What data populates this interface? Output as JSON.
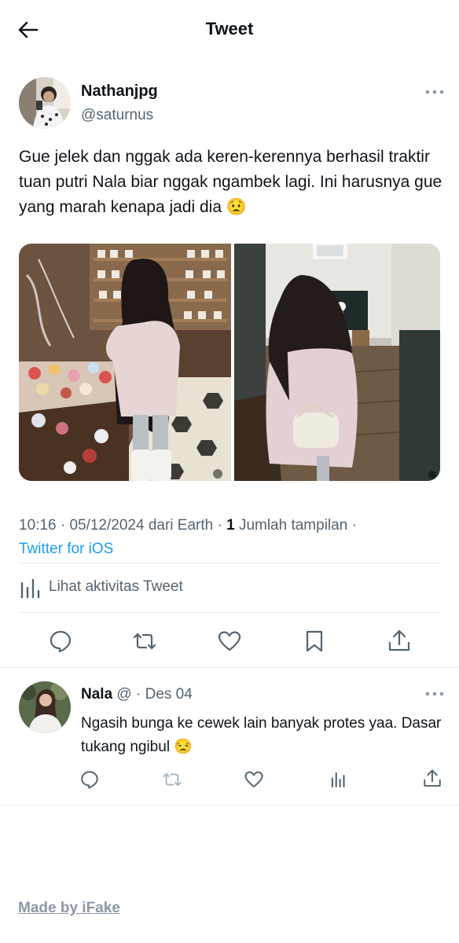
{
  "header": {
    "title": "Tweet",
    "back_icon": "arrow-left-icon"
  },
  "tweet": {
    "author": {
      "name": "Nathanjpg",
      "handle": "@saturnus"
    },
    "text": "Gue jelek dan nggak ada keren-kerennya berhasil traktir tuan putri Nala biar nggak ngambek lagi. Ini harusnya gue yang marah kenapa jadi dia 😟",
    "meta": {
      "time": "10:16",
      "date": "05/12/2024",
      "location": "dari Earth",
      "views_count": "1",
      "views_label": "Jumlah tampilan",
      "source": "Twitter for iOS"
    },
    "activity_label": "Lihat aktivitas Tweet",
    "actions": [
      "reply-icon",
      "retweet-icon",
      "like-icon",
      "bookmark-icon",
      "share-icon"
    ]
  },
  "reply": {
    "name": "Nala",
    "handle": "@",
    "date": "Des 04",
    "text": "Ngasih bunga ke cewek lain banyak protes yaa. Dasar tukang ngibul 😒",
    "actions": [
      "reply-icon",
      "retweet-icon",
      "like-icon",
      "views-icon",
      "share-icon"
    ]
  },
  "footer": {
    "watermark": "Made by iFake"
  },
  "colors": {
    "accent": "#1d9bf0",
    "secondary_text": "#536471",
    "divider": "#e6ecf0"
  }
}
